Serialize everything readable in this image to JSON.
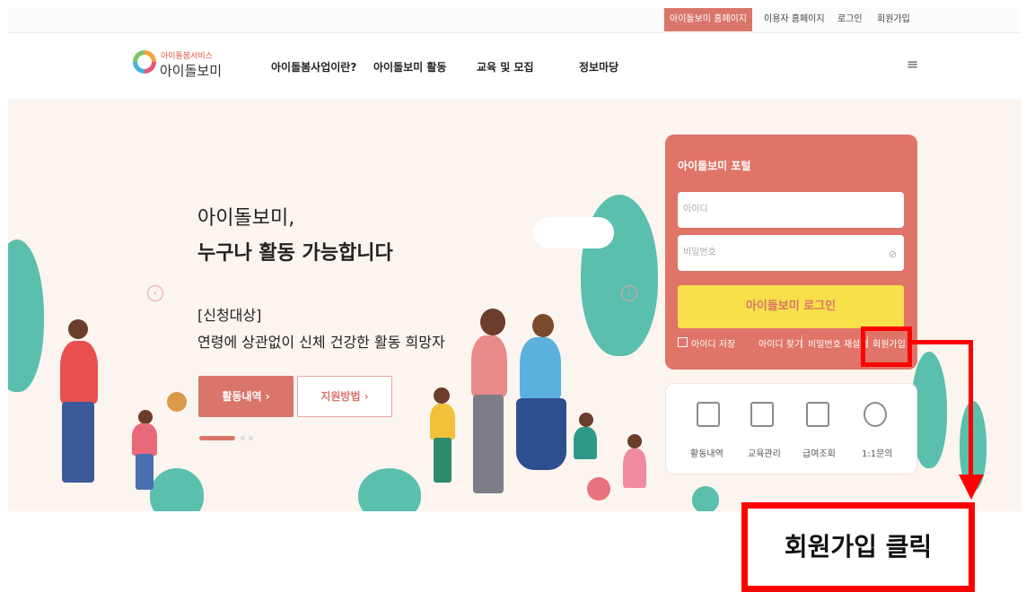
{
  "topbar": {
    "items": [
      "아이돌보미 홈페이지",
      "이용자 홈페이지",
      "로그인",
      "회원가입"
    ]
  },
  "header": {
    "logo_sub": "아이돌봄서비스",
    "logo_main": "아이돌보미",
    "nav": [
      "아이돌봄사업이란?",
      "아이돌보미 활동",
      "교육 및 모집",
      "정보마당"
    ],
    "menu_icon": "≡"
  },
  "hero": {
    "line1": "아이돌보미,",
    "line2": "누구나 활동 가능합니다",
    "target": "[신청대상]",
    "desc": "연령에 상관없이 신체 건강한 활동 희망자",
    "btn_activity": "활동내역  ›",
    "btn_support": "지원방법  ›"
  },
  "login": {
    "title": "아이돌보미 포털",
    "id_placeholder": "아이디",
    "pw_placeholder": "비밀번호",
    "login_button": "아이돌보미 로그인",
    "save_id": "아이디 저장",
    "find_id": "아이디 찾기",
    "reset_pw": "비밀번호 재설정",
    "signup": "회원가입"
  },
  "quick_menu": {
    "items": [
      "활동내역",
      "교육관리",
      "급여조회",
      "1:1문의"
    ]
  },
  "annotation": {
    "callout": "회원가입 클릭"
  },
  "colors": {
    "accent": "#d9756a",
    "login_panel": "#e07468",
    "login_button": "#f7e04a",
    "annotation": "#ff0000"
  }
}
